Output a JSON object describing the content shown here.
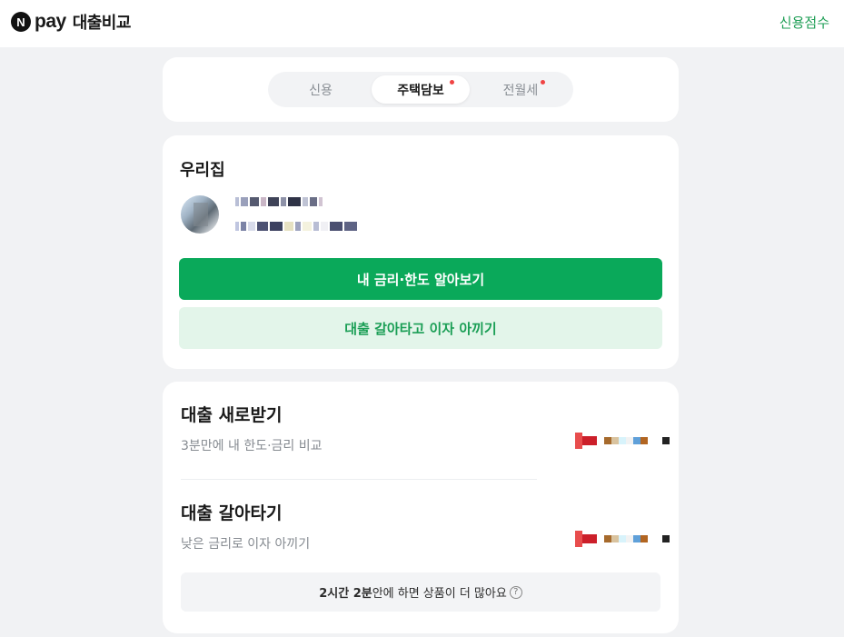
{
  "header": {
    "brand_badge": "N",
    "brand_pay": "pay",
    "service_name": "대출비교",
    "credit_link": "신용점수"
  },
  "tabs": [
    {
      "label": "신용",
      "active": false,
      "has_dot": false
    },
    {
      "label": "주택담보",
      "active": true,
      "has_dot": true
    },
    {
      "label": "전월세",
      "active": false,
      "has_dot": true
    }
  ],
  "home": {
    "title": "우리집",
    "primary_button": "내 금리·한도 알아보기",
    "secondary_button": "대출 갈아타고 이자 아끼기"
  },
  "loans": [
    {
      "title": "대출 새로받기",
      "subtitle": "3분만에 내 한도·금리 비교"
    },
    {
      "title": "대출 갈아타기",
      "subtitle": "낮은 금리로 이자 아끼기"
    }
  ],
  "info_bar": {
    "time_bold": "2시간 2분",
    "rest": " 안에 하면 상품이 더 많아요",
    "help_icon": "question-circle-icon"
  },
  "colors": {
    "accent_green": "#0aa95a",
    "light_green": "#e3f5ea",
    "notify_dot": "#f04343"
  }
}
